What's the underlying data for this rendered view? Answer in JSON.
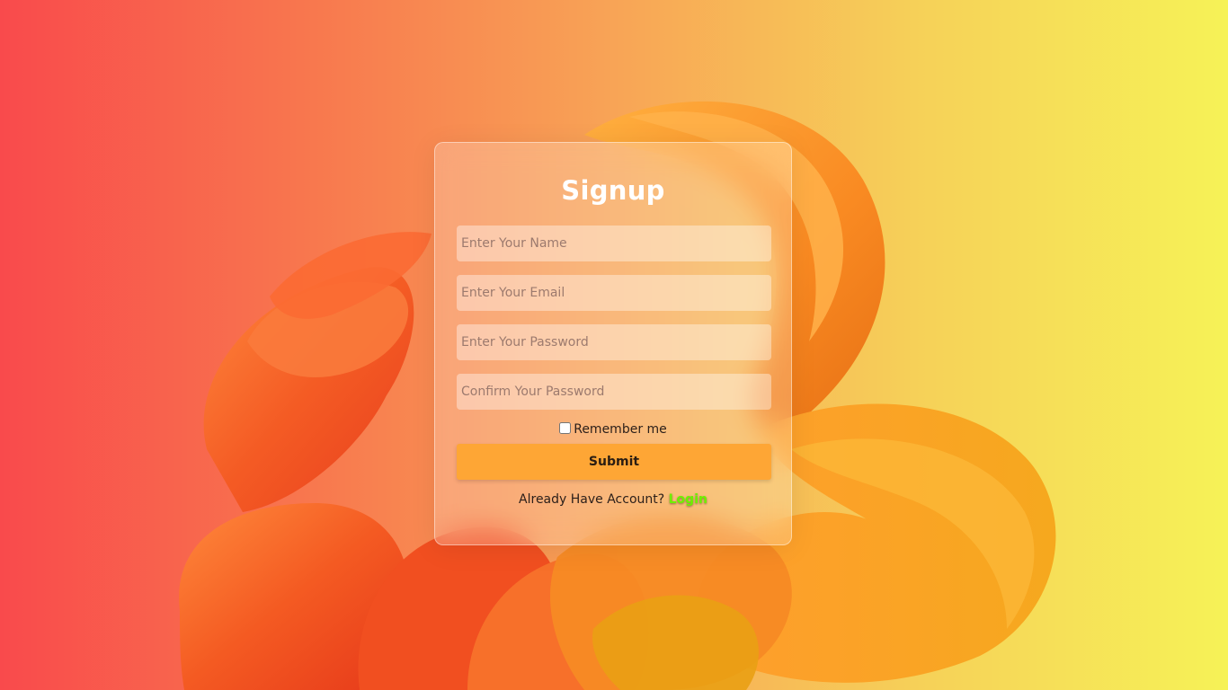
{
  "form": {
    "title": "Signup",
    "name_placeholder": "Enter Your Name",
    "email_placeholder": "Enter Your Email",
    "password_placeholder": "Enter Your Password",
    "confirm_placeholder": "Confirm Your Password",
    "remember_label": "Remember me",
    "remember_checked": false,
    "submit_label": "Submit",
    "already_text": "Already Have Account?",
    "login_label": "Login"
  },
  "colors": {
    "background_left": "#f94a4c",
    "background_right": "#f6f257",
    "submit_button": "#fea635",
    "login_link": "#6ff000",
    "title": "#ffffff"
  }
}
